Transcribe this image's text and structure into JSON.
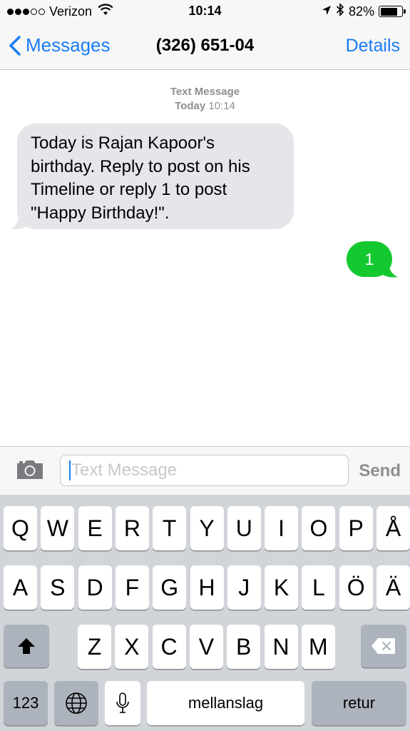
{
  "status_bar": {
    "carrier": "Verizon",
    "signal_bars_filled": 3,
    "signal_bars_total": 5,
    "time": "10:14",
    "battery_percent": "82%",
    "battery_level": 0.82,
    "icons": [
      "wifi-icon",
      "location-arrow-icon",
      "bluetooth-icon",
      "battery-icon"
    ]
  },
  "nav": {
    "back_label": "Messages",
    "title": "(326) 651-04",
    "details_label": "Details"
  },
  "conversation": {
    "timestamp_label": "Text Message",
    "timestamp_day": "Today",
    "timestamp_time": "10:14",
    "messages": [
      {
        "direction": "incoming",
        "lines": [
          "Today is Rajan Kapoor's",
          "birthday. Reply to post on his",
          "Timeline or reply 1 to post",
          "\"Happy Birthday!\"."
        ]
      },
      {
        "direction": "outgoing",
        "text": "1"
      }
    ]
  },
  "input": {
    "placeholder": "Text Message",
    "send_label": "Send"
  },
  "keyboard": {
    "row1": [
      "Q",
      "W",
      "E",
      "R",
      "T",
      "Y",
      "U",
      "I",
      "O",
      "P",
      "Å"
    ],
    "row2": [
      "A",
      "S",
      "D",
      "F",
      "G",
      "H",
      "J",
      "K",
      "L",
      "Ö",
      "Ä"
    ],
    "row3": [
      "Z",
      "X",
      "C",
      "V",
      "B",
      "N",
      "M"
    ],
    "numbers_label": "123",
    "space_label": "mellanslag",
    "return_label": "retur"
  },
  "colors": {
    "accent": "#1a7cf5",
    "incoming_bubble": "#e5e5ea",
    "outgoing_bubble": "#14c930",
    "keyboard_bg": "#d1d4d9"
  }
}
